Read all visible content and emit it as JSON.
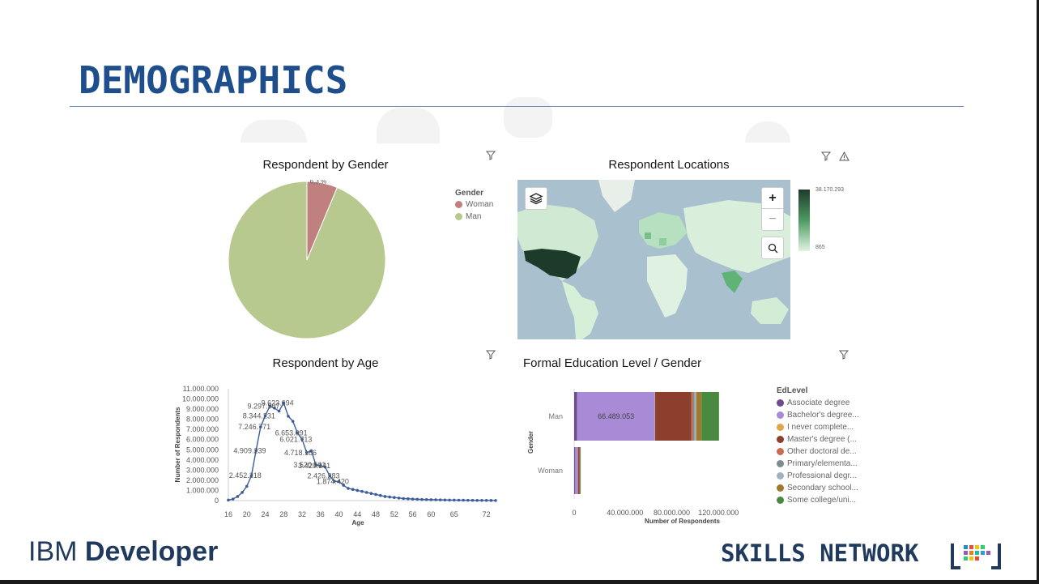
{
  "slide": {
    "title": "DEMOGRAPHICS"
  },
  "cards": {
    "gender": {
      "title": "Respondent by Gender",
      "legend_title": "Gender",
      "legend": [
        {
          "label": "Woman",
          "color": "#c08080"
        },
        {
          "label": "Man",
          "color": "#b8c98f"
        }
      ]
    },
    "locations": {
      "title": "Respondent Locations",
      "scale_max": "38.170.293",
      "scale_min": "865",
      "controls": {
        "zoom_in": "+",
        "zoom_out": "−"
      }
    },
    "age": {
      "title": "Respondent by Age"
    },
    "education": {
      "title": "Formal Education Level / Gender",
      "legend_title": "EdLevel",
      "legend": [
        {
          "label": "Associate degree",
          "color": "#6e4a8f"
        },
        {
          "label": "Bachelor's degree...",
          "color": "#a98ad6"
        },
        {
          "label": "I never complete...",
          "color": "#e0a64a"
        },
        {
          "label": "Master's degree (...",
          "color": "#8c3f2c"
        },
        {
          "label": "Other doctoral de...",
          "color": "#cc6a4c"
        },
        {
          "label": "Primary/elementa...",
          "color": "#7f8c8d"
        },
        {
          "label": "Professional degr...",
          "color": "#9fb3bf"
        },
        {
          "label": "Secondary school...",
          "color": "#a0782e"
        },
        {
          "label": "Some college/uni...",
          "color": "#4a8a3e"
        }
      ]
    }
  },
  "chart_data": [
    {
      "type": "pie",
      "title": "Respondent by Gender",
      "slices": [
        {
          "label": "Woman",
          "value": 6.3,
          "display": "6,3 %",
          "color": "#c08080"
        },
        {
          "label": "Man",
          "value": 93.7,
          "display": "93,7 %",
          "color": "#b8c98f"
        }
      ]
    },
    {
      "type": "line",
      "title": "Respondent by Age",
      "xlabel": "Age",
      "ylabel": "Number of Respondents",
      "xlim": [
        16,
        74
      ],
      "ylim": [
        0,
        11000000
      ],
      "x_ticks": [
        "16",
        "20",
        "24",
        "28",
        "32",
        "36",
        "40",
        "44",
        "48",
        "52",
        "56",
        "60",
        "65",
        "72"
      ],
      "y_ticks": [
        "0",
        "1.000.000",
        "2.000.000",
        "3.000.000",
        "4.000.000",
        "5.000.000",
        "6.000.000",
        "7.000.000",
        "8.000.000",
        "9.000.000",
        "10.000.000",
        "11.000.000"
      ],
      "x": [
        16,
        17,
        18,
        19,
        20,
        21,
        22,
        23,
        24,
        25,
        26,
        27,
        28,
        29,
        30,
        31,
        32,
        33,
        34,
        35,
        36,
        37,
        38,
        39,
        40,
        41,
        42,
        43,
        44,
        45,
        46,
        47,
        48,
        49,
        50,
        51,
        52,
        53,
        54,
        55,
        56,
        57,
        58,
        59,
        60,
        61,
        62,
        63,
        64,
        65,
        66,
        67,
        68,
        69,
        70,
        71,
        72,
        73,
        74
      ],
      "y": [
        50000,
        150000,
        400000,
        800000,
        1400000,
        2452218,
        4909239,
        7246771,
        8344231,
        9297907,
        9100000,
        8800000,
        9623694,
        8300000,
        7800000,
        6653091,
        6021713,
        4718186,
        4900000,
        3520501,
        3429141,
        3300000,
        2426283,
        1900000,
        1874420,
        1500000,
        1200000,
        1100000,
        1000000,
        900000,
        800000,
        700000,
        600000,
        500000,
        400000,
        350000,
        300000,
        250000,
        200000,
        180000,
        150000,
        130000,
        110000,
        100000,
        90000,
        80000,
        70000,
        60000,
        50000,
        45000,
        40000,
        35000,
        30000,
        25000,
        20000,
        18000,
        15000,
        12000,
        10000
      ],
      "labels": [
        {
          "x": 20,
          "y": 2452218,
          "text": "2.452.218"
        },
        {
          "x": 21,
          "y": 4909239,
          "text": "4.909.239"
        },
        {
          "x": 22,
          "y": 7246771,
          "text": "7.246.771"
        },
        {
          "x": 23,
          "y": 8344231,
          "text": "8.344.231"
        },
        {
          "x": 24,
          "y": 9297907,
          "text": "9.297.907"
        },
        {
          "x": 27,
          "y": 9623694,
          "text": "9.623.694"
        },
        {
          "x": 30,
          "y": 6653091,
          "text": "6.653.091"
        },
        {
          "x": 31,
          "y": 6021713,
          "text": "6.021.713"
        },
        {
          "x": 32,
          "y": 4718186,
          "text": "4.718.186"
        },
        {
          "x": 34,
          "y": 3520501,
          "text": "3.520.501"
        },
        {
          "x": 35,
          "y": 3429141,
          "text": "3.429.141"
        },
        {
          "x": 37,
          "y": 2426283,
          "text": "2.426.283"
        },
        {
          "x": 39,
          "y": 1874420,
          "text": "1.874.420"
        }
      ]
    },
    {
      "type": "bar",
      "orientation": "horizontal",
      "stacked": true,
      "title": "Formal Education Level / Gender",
      "xlabel": "Number of Respondents",
      "ylabel": "Gender",
      "xlim": [
        0,
        160000000
      ],
      "x_ticks": [
        "0",
        "40.000.000",
        "80.000.000",
        "120.000.000"
      ],
      "categories": [
        "Man",
        "Woman"
      ],
      "series": [
        {
          "name": "Associate degree",
          "color": "#6e4a8f",
          "values": [
            2500000,
            700000
          ]
        },
        {
          "name": "Bachelor's degree...",
          "color": "#a98ad6",
          "values": [
            66489053,
            2600000
          ]
        },
        {
          "name": "I never complete...",
          "color": "#e0a64a",
          "values": [
            300000,
            50000
          ]
        },
        {
          "name": "Master's degree (...",
          "color": "#8c3f2c",
          "values": [
            31000000,
            1200000
          ]
        },
        {
          "name": "Other doctoral de...",
          "color": "#cc6a4c",
          "values": [
            1200000,
            300000
          ]
        },
        {
          "name": "Primary/elementa...",
          "color": "#7f8c8d",
          "values": [
            1500000,
            100000
          ]
        },
        {
          "name": "Professional degr...",
          "color": "#9fb3bf",
          "values": [
            1400000,
            100000
          ]
        },
        {
          "name": "Secondary school...",
          "color": "#a0782e",
          "values": [
            4500000,
            150000
          ]
        },
        {
          "name": "Some college/uni...",
          "color": "#4a8a3e",
          "values": [
            15000000,
            400000
          ]
        }
      ],
      "labels": [
        {
          "category": "Man",
          "series": "Bachelor's degree...",
          "text": "66.489.053"
        }
      ]
    }
  ],
  "footer": {
    "ibm_a": "IBM ",
    "ibm_b": "Developer",
    "skills": "SKILLS NETWORK"
  }
}
